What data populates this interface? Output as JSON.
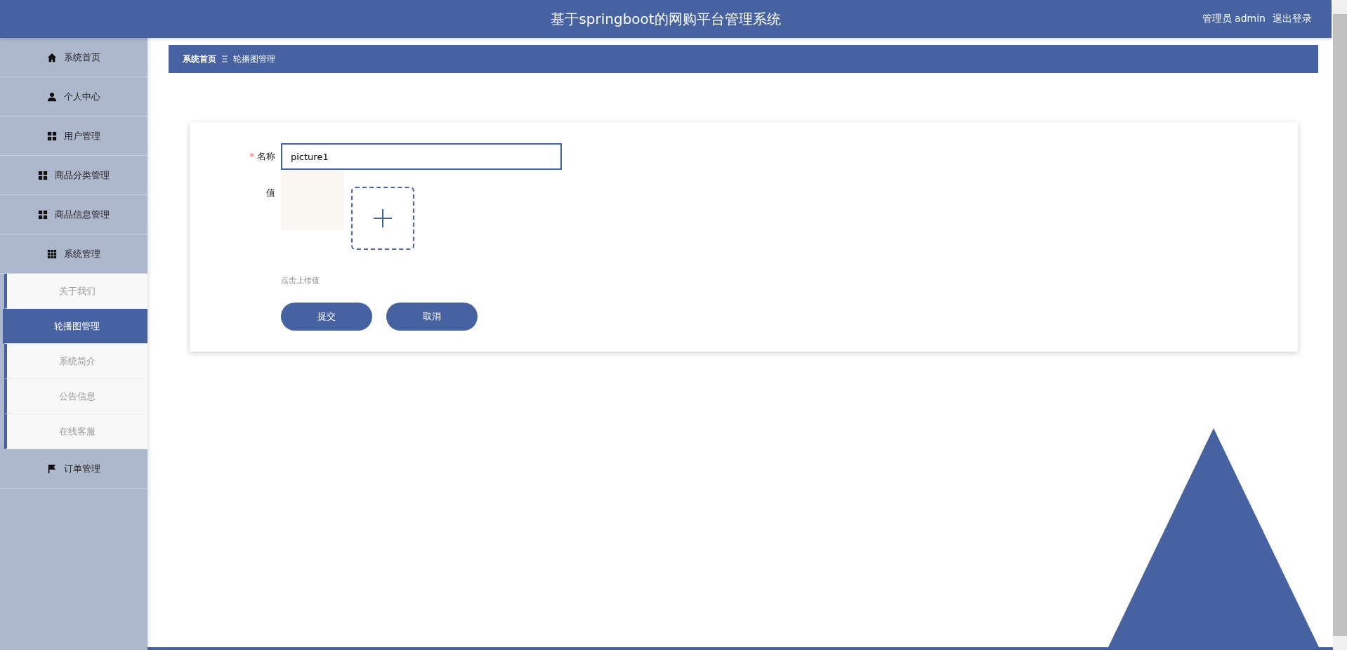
{
  "header": {
    "title": "基于springboot的网购平台管理系统",
    "user_label": "管理员 admin",
    "logout": "退出登录"
  },
  "sidebar": {
    "items": [
      {
        "label": "系统首页",
        "kind": "home"
      },
      {
        "label": "个人中心",
        "kind": "person"
      },
      {
        "label": "用户管理",
        "kind": "grid"
      },
      {
        "label": "商品分类管理",
        "kind": "grid"
      },
      {
        "label": "商品信息管理",
        "kind": "grid"
      },
      {
        "label": "系统管理",
        "kind": "apps",
        "children": [
          {
            "label": "关于我们",
            "selected": false
          },
          {
            "label": "轮播图管理",
            "selected": true
          },
          {
            "label": "系统简介",
            "selected": false
          },
          {
            "label": "公告信息",
            "selected": false
          },
          {
            "label": "在线客服",
            "selected": false
          }
        ]
      },
      {
        "label": "订单管理",
        "kind": "flag"
      }
    ]
  },
  "breadcrumb": [
    "系统首页",
    "轮播图管理"
  ],
  "form": {
    "name_field": {
      "label": "名称",
      "required_mark": "*",
      "value": "picture1"
    },
    "upload_field": {
      "label": "值",
      "hint": "点击上传值"
    },
    "buttons": [
      "提交",
      "取消"
    ]
  }
}
